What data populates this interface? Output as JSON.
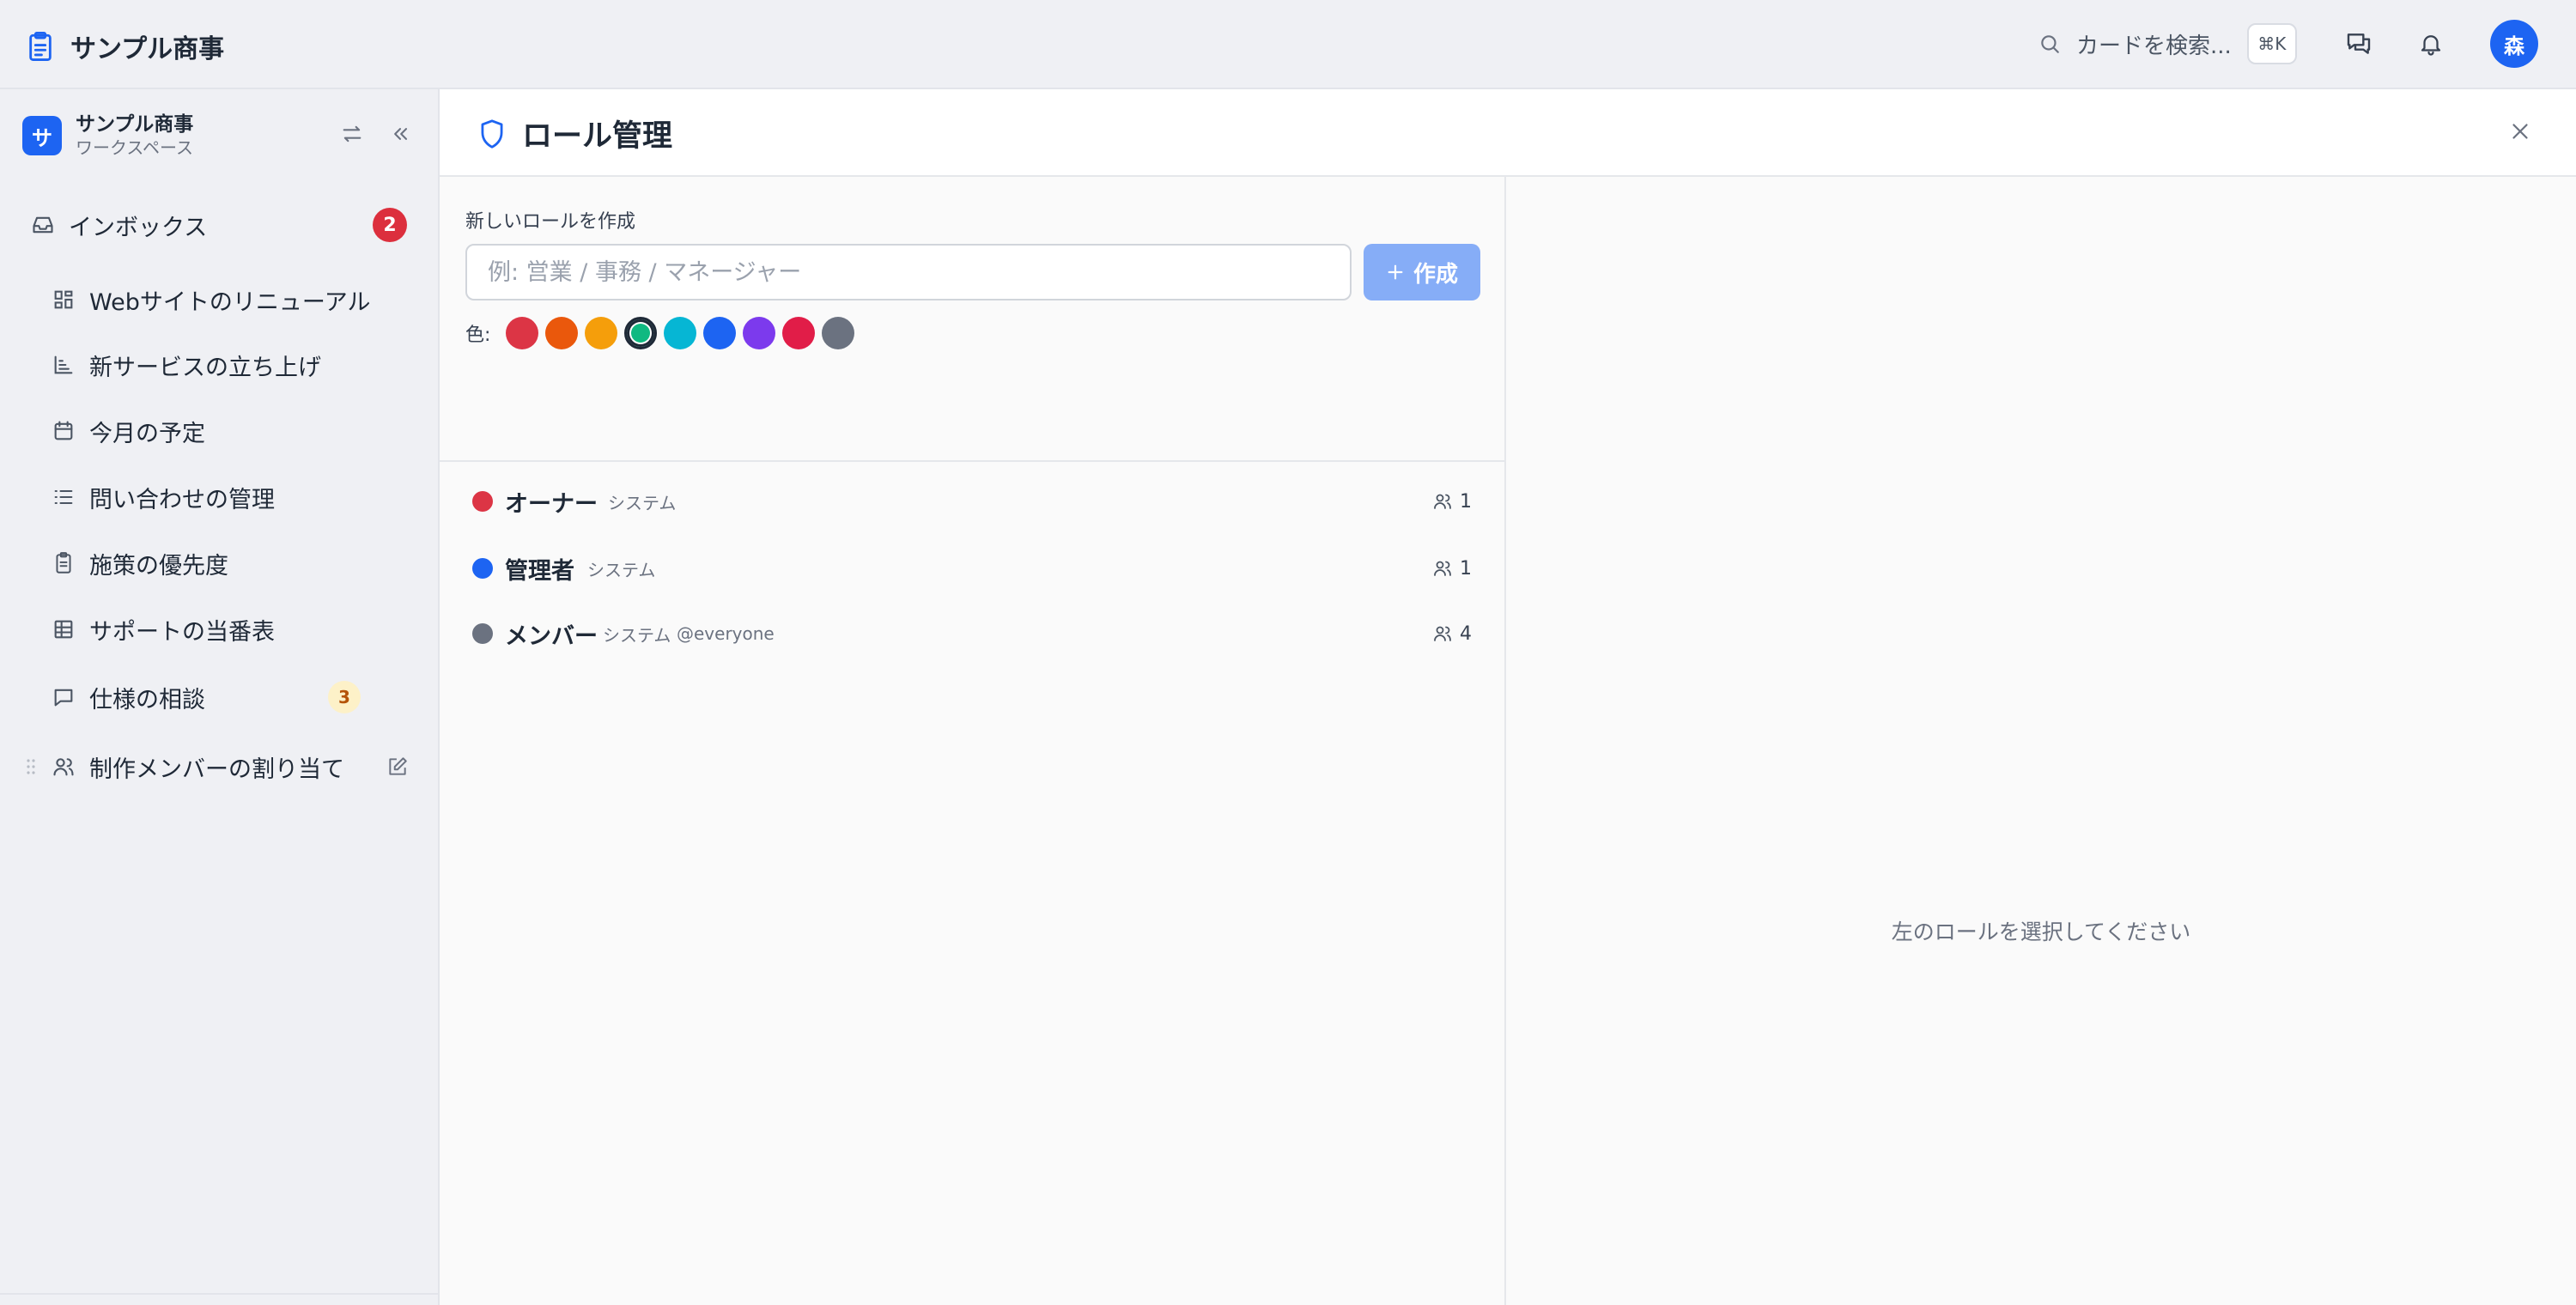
{
  "topbar": {
    "brand_title": "サンプル商事",
    "search_placeholder": "カードを検索...",
    "search_shortcut": "⌘K",
    "avatar_initial": "森",
    "icons": [
      "clipboard-icon",
      "search-icon",
      "messages-icon",
      "bell-icon"
    ]
  },
  "sidebar": {
    "workspace_initial": "サ",
    "workspace_name": "サンプル商事",
    "workspace_sub": "ワークスペース",
    "inbox": {
      "label": "インボックス",
      "badge": "2"
    },
    "items": [
      {
        "label": "Webサイトのリニューアル",
        "icon": "layout-grid-icon"
      },
      {
        "label": "新サービスの立ち上げ",
        "icon": "chart-icon"
      },
      {
        "label": "今月の予定",
        "icon": "calendar-icon"
      },
      {
        "label": "問い合わせの管理",
        "icon": "list-icon"
      },
      {
        "label": "施策の優先度",
        "icon": "clipboard-icon"
      },
      {
        "label": "サポートの当番表",
        "icon": "table-icon"
      },
      {
        "label": "仕様の相談",
        "icon": "chat-icon",
        "badge": "3"
      },
      {
        "label": "制作メンバーの割り当て",
        "icon": "users-icon"
      }
    ]
  },
  "panel": {
    "title": "ロール管理",
    "create_label": "新しいロールを作成",
    "input_placeholder": "例: 営業 / 事務 / マネージャー",
    "create_button": "作成",
    "color_label": "色:",
    "colors": [
      "#dc3545",
      "#ea580c",
      "#f59e0b",
      "#10b981",
      "#06b6d4",
      "#1d64f2",
      "#7c3aed",
      "#e11d48",
      "#6b7280"
    ],
    "selected_color_index": 3,
    "roles": [
      {
        "name": "オーナー",
        "tag": "システム",
        "mention": "",
        "count": "1",
        "color": "#dc3545"
      },
      {
        "name": "管理者",
        "tag": "システム",
        "mention": "",
        "count": "1",
        "color": "#1d64f2"
      },
      {
        "name": "メンバー",
        "tag": "システム",
        "mention": "@everyone",
        "count": "4",
        "color": "#6b7280"
      }
    ],
    "empty_message": "左のロールを選択してください"
  }
}
